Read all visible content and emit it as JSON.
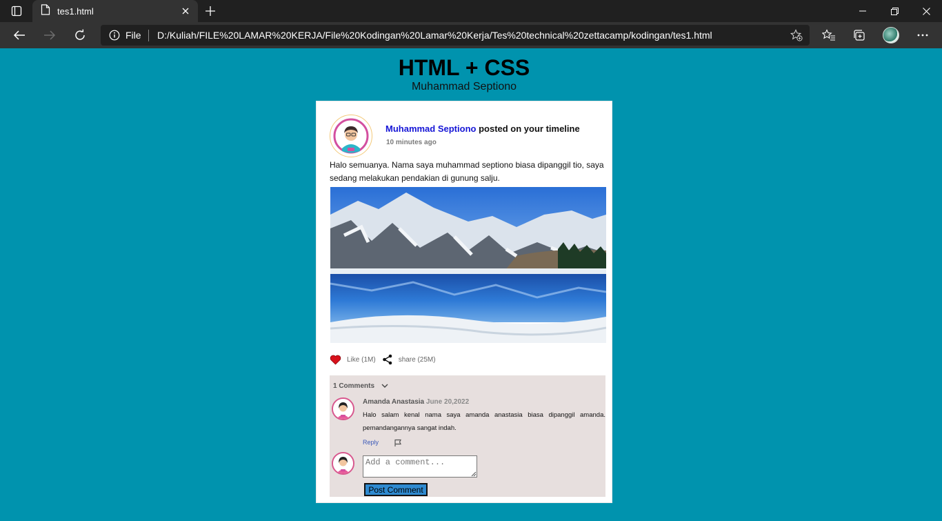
{
  "browser": {
    "tab_title": "tes1.html",
    "scheme_label": "File",
    "url": "D:/Kuliah/FILE%20LAMAR%20KERJA/File%20Kodingan%20Lamar%20Kerja/Tes%20technical%20zettacamp/kodingan/tes1.html",
    "icons": [
      "tab-actions-icon",
      "page-icon",
      "close-icon",
      "plus-icon",
      "minimize-icon",
      "restore-icon",
      "close-window-icon",
      "back-icon",
      "forward-icon",
      "refresh-icon",
      "info-icon",
      "add-favorite-icon",
      "favorites-icon",
      "collections-icon",
      "profile-avatar",
      "more-icon"
    ]
  },
  "page": {
    "title": "HTML + CSS",
    "subtitle": "Muhammad Septiono"
  },
  "post": {
    "author": "Muhammad Septiono",
    "action_text": "posted on your timeline",
    "time": "10 minutes ago",
    "text": "Halo semuanya. Nama saya muhammad septiono biasa dipanggil tio, saya sedang melakukan pendakian di gunung salju.",
    "image": "snowy-mountain-lake-photo",
    "like_label": "Like (1M)",
    "share_label": "share (25M)",
    "colors": {
      "background": "#0093ae",
      "author_link": "#1515d6",
      "comments_bg": "#e7dfde",
      "button": "#2f8ad0"
    }
  },
  "comments": {
    "count_label": "1 Comments",
    "items": [
      {
        "author": "Amanda Anastasia",
        "date": "June 20,2022",
        "text": "Halo salam kenal nama saya amanda anastasia biasa dipanggil amanda. pemandangannya sangat indah.",
        "reply_label": "Reply"
      }
    ],
    "input_placeholder": "Add a comment...",
    "submit_label": "Post Comment"
  }
}
